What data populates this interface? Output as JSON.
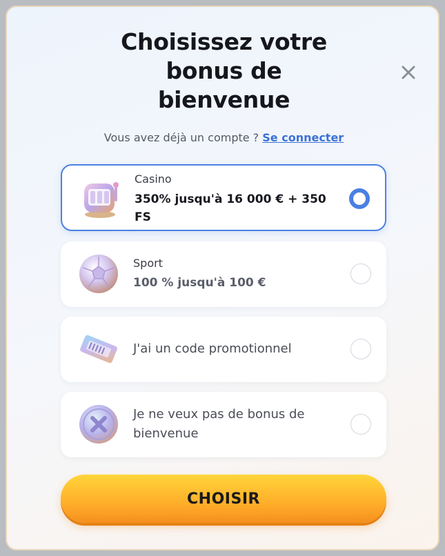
{
  "modal": {
    "title_lines": [
      "Choisissez votre",
      "bonus de",
      "bienvenue"
    ],
    "close_icon": "close-icon",
    "subtitle_text": "Vous avez déjà un compte ?",
    "login_link": "Se connecter"
  },
  "options": [
    {
      "label": "Casino",
      "value": "350% jusqu'à 16 000 € + 350",
      "value_line2": "FS",
      "icon": "slot-machine-icon",
      "selected": true
    },
    {
      "label": "Sport",
      "value": "100 % jusqu'à 100 €",
      "icon": "soccer-ball-icon",
      "selected": false
    },
    {
      "text": "J'ai un code promotionnel",
      "icon": "ticket-icon",
      "selected": false
    },
    {
      "text_line1": "Je ne veux pas de bonus de",
      "text_line2": "bienvenue",
      "icon": "no-bonus-coin-icon",
      "selected": false
    }
  ],
  "cta": {
    "label": "CHOISIR"
  },
  "colors": {
    "accent": "#4a80e2",
    "link": "#3b71d6",
    "cta_top": "#ffd53a",
    "cta_bottom": "#f58f1e"
  }
}
